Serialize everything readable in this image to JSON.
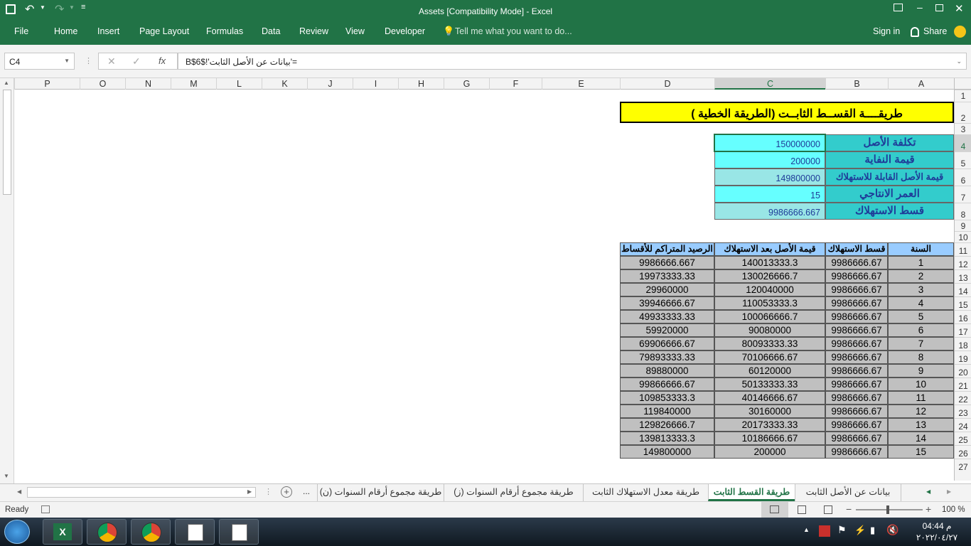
{
  "window": {
    "title": "Assets  [Compatibility Mode] - Excel"
  },
  "ribbon": {
    "tabs": [
      "File",
      "Home",
      "Insert",
      "Page Layout",
      "Formulas",
      "Data",
      "Review",
      "View",
      "Developer"
    ],
    "tell_me": "Tell me what you want to do...",
    "sign_in": "Sign in",
    "share": "Share"
  },
  "formula_bar": {
    "name_box": "C4",
    "formula": "='بيانات عن الأصل الثابت'!$B$6"
  },
  "columns": [
    "P",
    "O",
    "N",
    "M",
    "L",
    "K",
    "J",
    "I",
    "H",
    "G",
    "F",
    "E",
    "D",
    "C",
    "B",
    "A"
  ],
  "rows": [
    "1",
    "2",
    "3",
    "4",
    "5",
    "6",
    "7",
    "8",
    "9",
    "10",
    "11",
    "12",
    "13",
    "14",
    "15",
    "16",
    "17",
    "18",
    "19",
    "20",
    "21",
    "22",
    "23",
    "24",
    "25",
    "26",
    "27"
  ],
  "sheet": {
    "title": "طريقــــة القســط الثابــت (الطريقة الخطية )",
    "params": [
      {
        "label": "تكلفة الأصل",
        "value": "150000000"
      },
      {
        "label": "قيمة النفاية",
        "value": "200000"
      },
      {
        "label": "قيمة الأصل القابلة للاستهلاك",
        "value": "149800000"
      },
      {
        "label": "العمر الانتاجي",
        "value": "15"
      },
      {
        "label": "قسط الاستهلاك",
        "value": "9986666.667"
      }
    ],
    "table_headers": [
      "السنة",
      "قسط الاستهلاك",
      "قيمة الأصل بعد الاستهلاك",
      "الرصيد المتراكم للأقساط"
    ],
    "table_rows": [
      [
        "1",
        "9986666.67",
        "140013333.3",
        "9986666.667"
      ],
      [
        "2",
        "9986666.67",
        "130026666.7",
        "19973333.33"
      ],
      [
        "3",
        "9986666.67",
        "120040000",
        "29960000"
      ],
      [
        "4",
        "9986666.67",
        "110053333.3",
        "39946666.67"
      ],
      [
        "5",
        "9986666.67",
        "100066666.7",
        "49933333.33"
      ],
      [
        "6",
        "9986666.67",
        "90080000",
        "59920000"
      ],
      [
        "7",
        "9986666.67",
        "80093333.33",
        "69906666.67"
      ],
      [
        "8",
        "9986666.67",
        "70106666.67",
        "79893333.33"
      ],
      [
        "9",
        "9986666.67",
        "60120000",
        "89880000"
      ],
      [
        "10",
        "9986666.67",
        "50133333.33",
        "99866666.67"
      ],
      [
        "11",
        "9986666.67",
        "40146666.67",
        "109853333.3"
      ],
      [
        "12",
        "9986666.67",
        "30160000",
        "119840000"
      ],
      [
        "13",
        "9986666.67",
        "20173333.33",
        "129826666.7"
      ],
      [
        "14",
        "9986666.67",
        "10186666.67",
        "139813333.3"
      ],
      [
        "15",
        "9986666.67",
        "200000",
        "149800000"
      ]
    ]
  },
  "sheet_tabs": [
    "بيانات عن الأصل الثابت",
    "طريقة القسط الثابت",
    "طريقة معدل الاستهلاك الثابت",
    "طريقة مجموع أرقام السنوات (ز)",
    "طريقة مجموع أرقام السنوات (ن)"
  ],
  "sheet_tabs_more": "...",
  "status": {
    "ready": "Ready",
    "zoom": "100 %"
  },
  "taskbar": {
    "time": "04:44 م",
    "date": "٢٠٢٢/٠٤/٢٧"
  },
  "colors": {
    "excel_green": "#217346",
    "title_fill": "#ffff00",
    "label_fill": "#33cccc",
    "value_fill": "#66ffff",
    "header_fill": "#99ccff",
    "row_fill": "#c0c0c0"
  }
}
